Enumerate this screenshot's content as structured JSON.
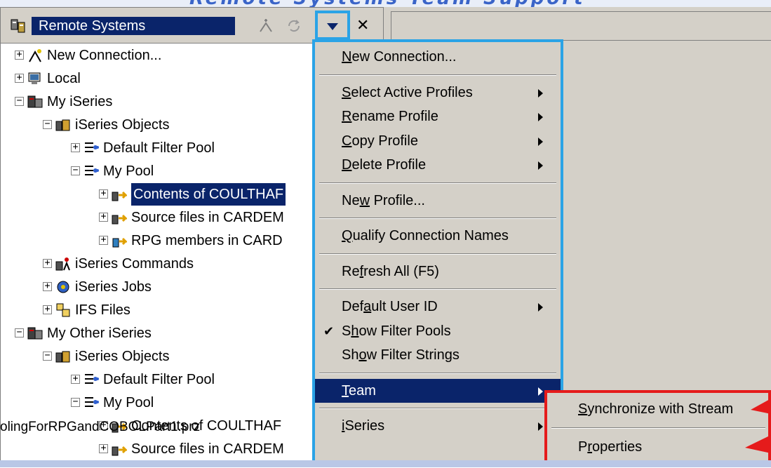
{
  "slide": {
    "title_fragment": "Remote Systems Team Support"
  },
  "view": {
    "title": "Remote Systems",
    "tree": [
      {
        "label": "New Connection...",
        "icon": "new-connection-icon",
        "level": 0,
        "expander": "+"
      },
      {
        "label": "Local",
        "icon": "local-system-icon",
        "level": 0,
        "expander": "+"
      },
      {
        "label": "My iSeries",
        "icon": "iseries-connection-icon",
        "level": 0,
        "expander": "-"
      },
      {
        "label": "iSeries Objects",
        "icon": "iseries-objects-icon",
        "level": 1,
        "expander": "-"
      },
      {
        "label": "Default Filter Pool",
        "icon": "filter-pool-icon",
        "level": 2,
        "expander": "+"
      },
      {
        "label": "My Pool",
        "icon": "filter-pool-icon",
        "level": 2,
        "expander": "-"
      },
      {
        "label": "Contents of COULTHAF",
        "icon": "filter-icon",
        "level": 3,
        "expander": "+",
        "selected": true
      },
      {
        "label": "Source files in CARDEM",
        "icon": "filter-icon",
        "level": 3,
        "expander": "+"
      },
      {
        "label": "RPG members in CARD",
        "icon": "member-filter-icon",
        "level": 3,
        "expander": "+"
      },
      {
        "label": "iSeries Commands",
        "icon": "iseries-commands-icon",
        "level": 1,
        "expander": "+"
      },
      {
        "label": "iSeries Jobs",
        "icon": "iseries-jobs-icon",
        "level": 1,
        "expander": "+"
      },
      {
        "label": "IFS Files",
        "icon": "ifs-files-icon",
        "level": 1,
        "expander": "+"
      },
      {
        "label": "My Other iSeries",
        "icon": "iseries-connection-icon",
        "level": 0,
        "expander": "-"
      },
      {
        "label": "iSeries Objects",
        "icon": "iseries-objects-icon",
        "level": 1,
        "expander": "-"
      },
      {
        "label": "Default Filter Pool",
        "icon": "filter-pool-icon",
        "level": 2,
        "expander": "+"
      },
      {
        "label": "My Pool",
        "icon": "filter-pool-icon",
        "level": 2,
        "expander": "-"
      },
      {
        "label": "Contents of COULTHAF",
        "icon": "filter-icon",
        "level": 3,
        "expander": "+"
      },
      {
        "label": "Source files in CARDEM",
        "icon": "filter-icon",
        "level": 3,
        "expander": "+"
      }
    ]
  },
  "menu": {
    "items": [
      {
        "label": "New Connection...",
        "mnemonic": "N",
        "submenu": false
      },
      {
        "sep": true
      },
      {
        "label": "Select Active Profiles",
        "mnemonic": "S",
        "submenu": true
      },
      {
        "label": "Rename Profile",
        "mnemonic": "R",
        "submenu": true
      },
      {
        "label": "Copy Profile",
        "mnemonic": "C",
        "submenu": true
      },
      {
        "label": "Delete Profile",
        "mnemonic": "D",
        "submenu": true
      },
      {
        "sep": true
      },
      {
        "label": "New Profile...",
        "mnemonic": "w",
        "submenu": false
      },
      {
        "sep": true
      },
      {
        "label": "Qualify Connection Names",
        "mnemonic": "Q",
        "submenu": false
      },
      {
        "sep": true
      },
      {
        "label": "Refresh All (F5)",
        "mnemonic": "f",
        "submenu": false
      },
      {
        "sep": true
      },
      {
        "label": "Default User ID",
        "mnemonic": "a",
        "submenu": true
      },
      {
        "label": "Show Filter Pools",
        "mnemonic": "h",
        "submenu": false,
        "checked": true
      },
      {
        "label": "Show Filter Strings",
        "mnemonic": "o",
        "submenu": false
      },
      {
        "sep": true
      },
      {
        "label": "Team",
        "mnemonic": "T",
        "submenu": true,
        "active": true
      },
      {
        "sep": true
      },
      {
        "label": "iSeries",
        "mnemonic": "i",
        "submenu": true
      }
    ]
  },
  "submenu": {
    "items": [
      {
        "label": "Synchronize with Stream",
        "mnemonic": "S"
      },
      {
        "label": "Properties",
        "mnemonic": "r"
      }
    ]
  },
  "footer": {
    "filename": "olingForRPGandCOBOLPart1.prz"
  },
  "colors": {
    "selection": "#0a246a",
    "highlight_box": "#2aa3e6",
    "callout": "#e51b1b",
    "chrome": "#d4d0c8"
  }
}
